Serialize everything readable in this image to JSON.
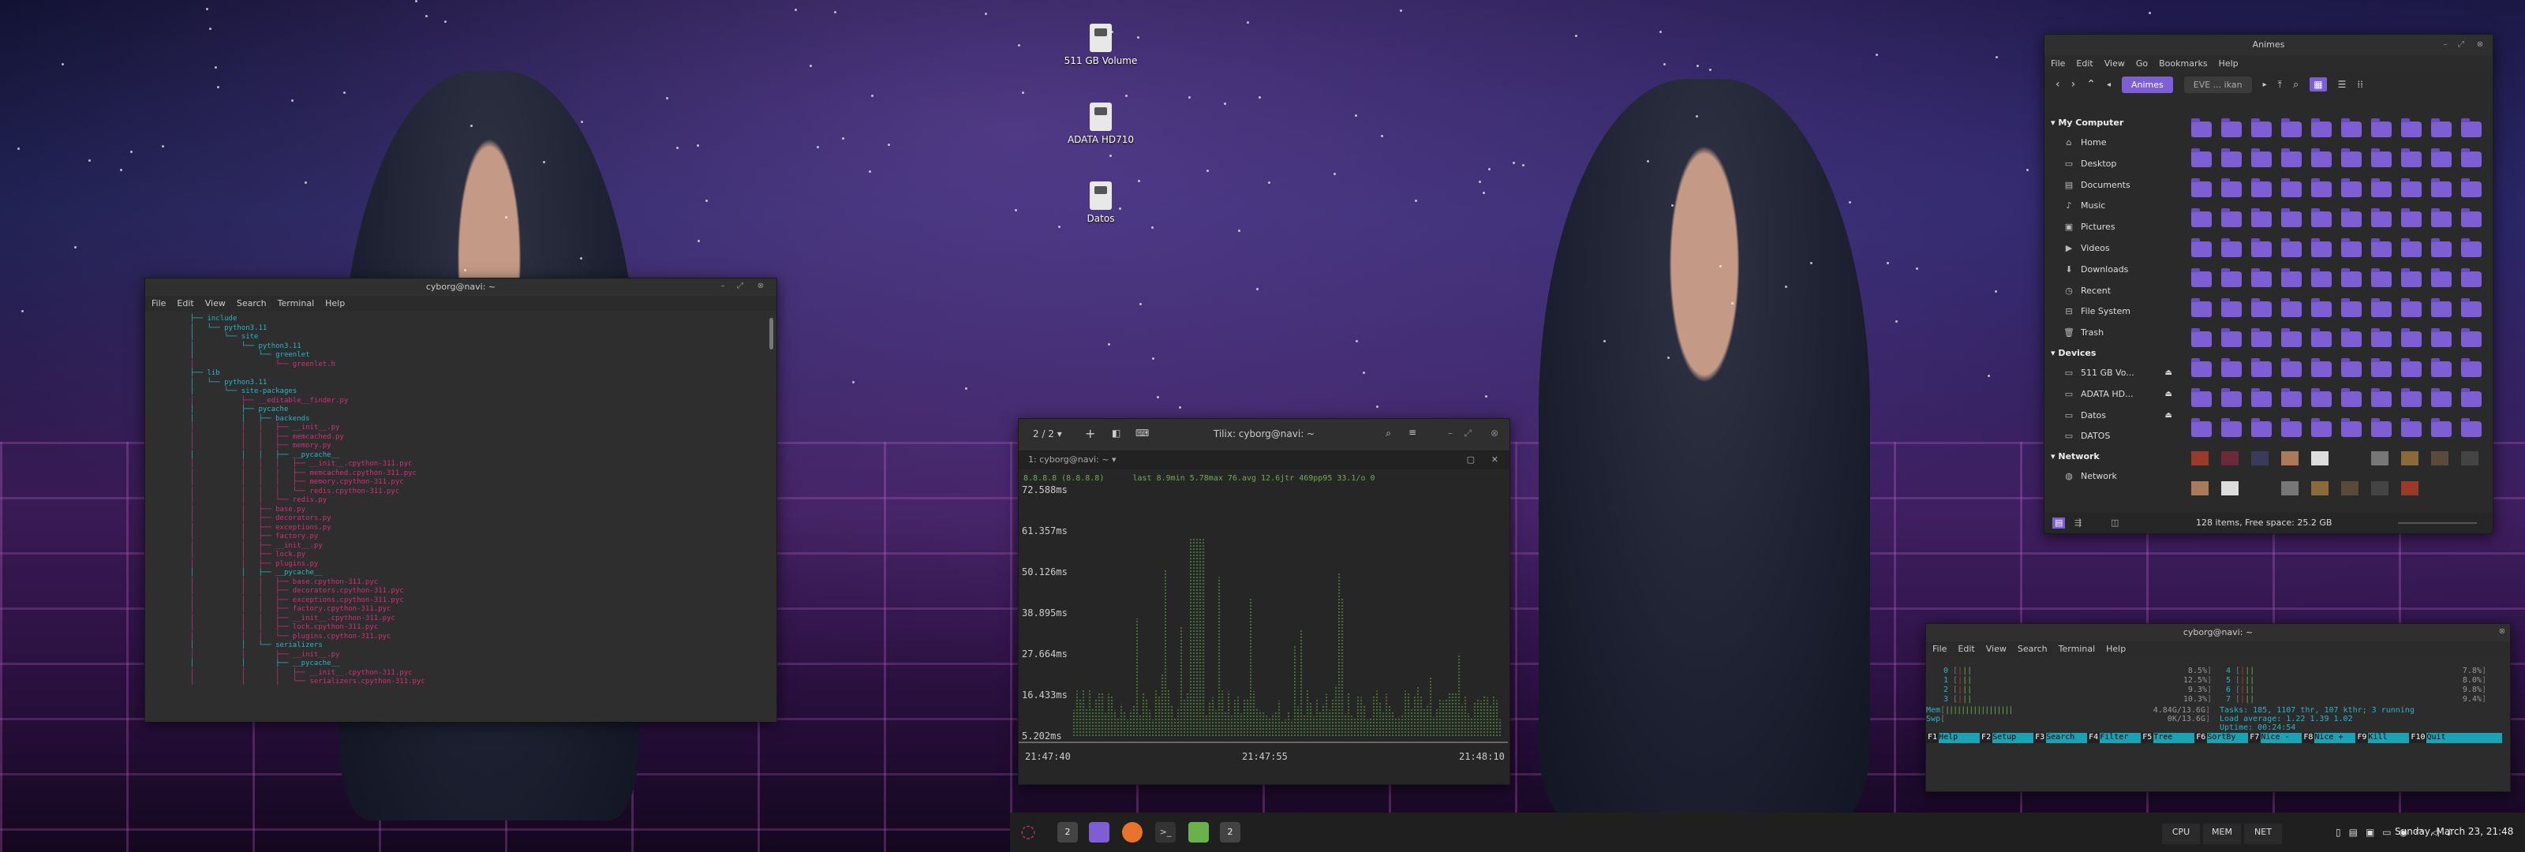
{
  "term_left": {
    "title": "cyborg@navi: ~",
    "menu": [
      "File",
      "Edit",
      "View",
      "Search",
      "Terminal",
      "Help"
    ],
    "lines": [
      {
        "t": "         ├── include",
        "c": "c-cyan"
      },
      {
        "t": "         │   └── python3.11",
        "c": "c-cyan"
      },
      {
        "t": "         │       └── site",
        "c": "c-cyan"
      },
      {
        "t": "         │           └── python3.11",
        "c": "c-cyan"
      },
      {
        "t": "         │               └── greenlet",
        "c": "c-cyan"
      },
      {
        "t": "         │                   └── greenlet.h",
        "c": "c-pink"
      },
      {
        "t": "         ├── lib",
        "c": "c-cyan"
      },
      {
        "t": "         │   └── python3.11",
        "c": "c-cyan"
      },
      {
        "t": "         │       └── site-packages",
        "c": "c-cyan"
      },
      {
        "t": "         │           ├── __editable__finder.py",
        "c": "c-pink"
      },
      {
        "t": "         │           ├── pycache",
        "c": "c-cyan"
      },
      {
        "t": "         │           │   ├── backends",
        "c": "c-cyan"
      },
      {
        "t": "         │           │   │   ├── __init__.py",
        "c": "c-pink"
      },
      {
        "t": "         │           │   │   ├── memcached.py",
        "c": "c-pink"
      },
      {
        "t": "         │           │   │   ├── memory.py",
        "c": "c-pink"
      },
      {
        "t": "         │           │   │   ├── __pycache__",
        "c": "c-cyan"
      },
      {
        "t": "         │           │   │   │   ├── __init__.cpython-311.pyc",
        "c": "c-pink"
      },
      {
        "t": "         │           │   │   │   ├── memcached.cpython-311.pyc",
        "c": "c-pink"
      },
      {
        "t": "         │           │   │   │   ├── memory.cpython-311.pyc",
        "c": "c-pink"
      },
      {
        "t": "         │           │   │   │   └── redis.cpython-311.pyc",
        "c": "c-pink"
      },
      {
        "t": "         │           │   │   └── redis.py",
        "c": "c-pink"
      },
      {
        "t": "         │           │   ├── base.py",
        "c": "c-pink"
      },
      {
        "t": "         │           │   ├── decorators.py",
        "c": "c-pink"
      },
      {
        "t": "         │           │   ├── exceptions.py",
        "c": "c-pink"
      },
      {
        "t": "         │           │   ├── factory.py",
        "c": "c-pink"
      },
      {
        "t": "         │           │   ├── __init__.py",
        "c": "c-pink"
      },
      {
        "t": "         │           │   ├── lock.py",
        "c": "c-pink"
      },
      {
        "t": "         │           │   ├── plugins.py",
        "c": "c-pink"
      },
      {
        "t": "         │           │   ├── __pycache__",
        "c": "c-cyan"
      },
      {
        "t": "         │           │   │   ├── base.cpython-311.pyc",
        "c": "c-pink"
      },
      {
        "t": "         │           │   │   ├── decorators.cpython-311.pyc",
        "c": "c-pink"
      },
      {
        "t": "         │           │   │   ├── exceptions.cpython-311.pyc",
        "c": "c-pink"
      },
      {
        "t": "         │           │   │   ├── factory.cpython-311.pyc",
        "c": "c-pink"
      },
      {
        "t": "         │           │   │   ├── __init__.cpython-311.pyc",
        "c": "c-pink"
      },
      {
        "t": "         │           │   │   ├── lock.cpython-311.pyc",
        "c": "c-pink"
      },
      {
        "t": "         │           │   │   └── plugins.cpython-311.pyc",
        "c": "c-pink"
      },
      {
        "t": "         │           │   └── serializers",
        "c": "c-cyan"
      },
      {
        "t": "         │           │       ├── __init__.py",
        "c": "c-pink"
      },
      {
        "t": "         │           │       ├── __pycache__",
        "c": "c-cyan"
      },
      {
        "t": "         │           │       │   ├── __init__.cpython-311.pyc",
        "c": "c-pink"
      },
      {
        "t": "         │           │       │   └── serializers.cpython-311.pyc",
        "c": "c-pink"
      }
    ]
  },
  "desktop": {
    "icons": [
      {
        "label": "511 GB Volume"
      },
      {
        "label": "ADATA HD710"
      },
      {
        "label": "Datos"
      }
    ]
  },
  "tilix": {
    "title": "Tilix: cyborg@navi: ~",
    "session": "2 / 2",
    "tab": "1: cyborg@navi: ~",
    "header_line": "8.8.8.8 (8.8.8.8)      last 8.9min 5.78max 76.avg 12.6jtr 469pp95 33.1/o 0",
    "y_labels": [
      "72.588ms",
      "61.357ms",
      "50.126ms",
      "38.895ms",
      "27.664ms",
      "16.433ms",
      "5.202ms"
    ],
    "x_labels": [
      "21:47:40",
      "21:47:55",
      "21:48:10"
    ]
  },
  "files": {
    "title": "Animes",
    "menu": [
      "File",
      "Edit",
      "View",
      "Go",
      "Bookmarks",
      "Help"
    ],
    "crumbs": [
      "Animes",
      "EVE ... ikan"
    ],
    "my_computer": "My Computer",
    "places": [
      "Home",
      "Desktop",
      "Documents",
      "Music",
      "Pictures",
      "Videos",
      "Downloads",
      "Recent",
      "File System",
      "Trash"
    ],
    "place_icons": [
      "⌂",
      "▭",
      "▤",
      "♪",
      "▣",
      "▶",
      "⬇",
      "◷",
      "⊟",
      "🗑"
    ],
    "devices_head": "Devices",
    "devices": [
      "511 GB Vo...",
      "ADATA HD...",
      "Datos",
      "DATOS"
    ],
    "network_head": "Network",
    "network": [
      "Network"
    ],
    "status": "128 items, Free space: 25.2 GB"
  },
  "htop": {
    "title": "cyborg@navi: ~",
    "menu": [
      "File",
      "Edit",
      "View",
      "Search",
      "Terminal",
      "Help"
    ],
    "cpu_left": [
      {
        "id": "0",
        "pct": "8.5%"
      },
      {
        "id": "1",
        "pct": "12.5%"
      },
      {
        "id": "2",
        "pct": "9.3%"
      },
      {
        "id": "3",
        "pct": "10.3%"
      }
    ],
    "cpu_right": [
      {
        "id": "4",
        "pct": "7.8%"
      },
      {
        "id": "5",
        "pct": "8.0%"
      },
      {
        "id": "6",
        "pct": "9.8%"
      },
      {
        "id": "7",
        "pct": "9.4%"
      }
    ],
    "mem": "4.84G/13.6G",
    "swp": "0K/13.6G",
    "tasks": "Tasks: 185, 1107 thr, 107 kthr; 3 running",
    "load": "Load average: 1.22 1.39 1.02",
    "uptime": "Uptime: 00:24:54",
    "fkeys": [
      {
        "k": "F1",
        "l": "Help"
      },
      {
        "k": "F2",
        "l": "Setup"
      },
      {
        "k": "F3",
        "l": "Search"
      },
      {
        "k": "F4",
        "l": "Filter"
      },
      {
        "k": "F5",
        "l": "Tree"
      },
      {
        "k": "F6",
        "l": "SortBy"
      },
      {
        "k": "F7",
        "l": "Nice -"
      },
      {
        "k": "F8",
        "l": "Nice +"
      },
      {
        "k": "F9",
        "l": "Kill"
      },
      {
        "k": "F10",
        "l": "Quit"
      }
    ]
  },
  "taskbar": {
    "cpu_label": "CPU",
    "mem_label": "MEM",
    "net_label": "NET",
    "workspace": "2",
    "clock": "Sunday, March 23, 21:48"
  },
  "colors": {
    "accent": "#7d5fd3",
    "graph": "#6ab04c",
    "tree_dir": "#2bb4c6",
    "tree_file": "#d1307a"
  }
}
